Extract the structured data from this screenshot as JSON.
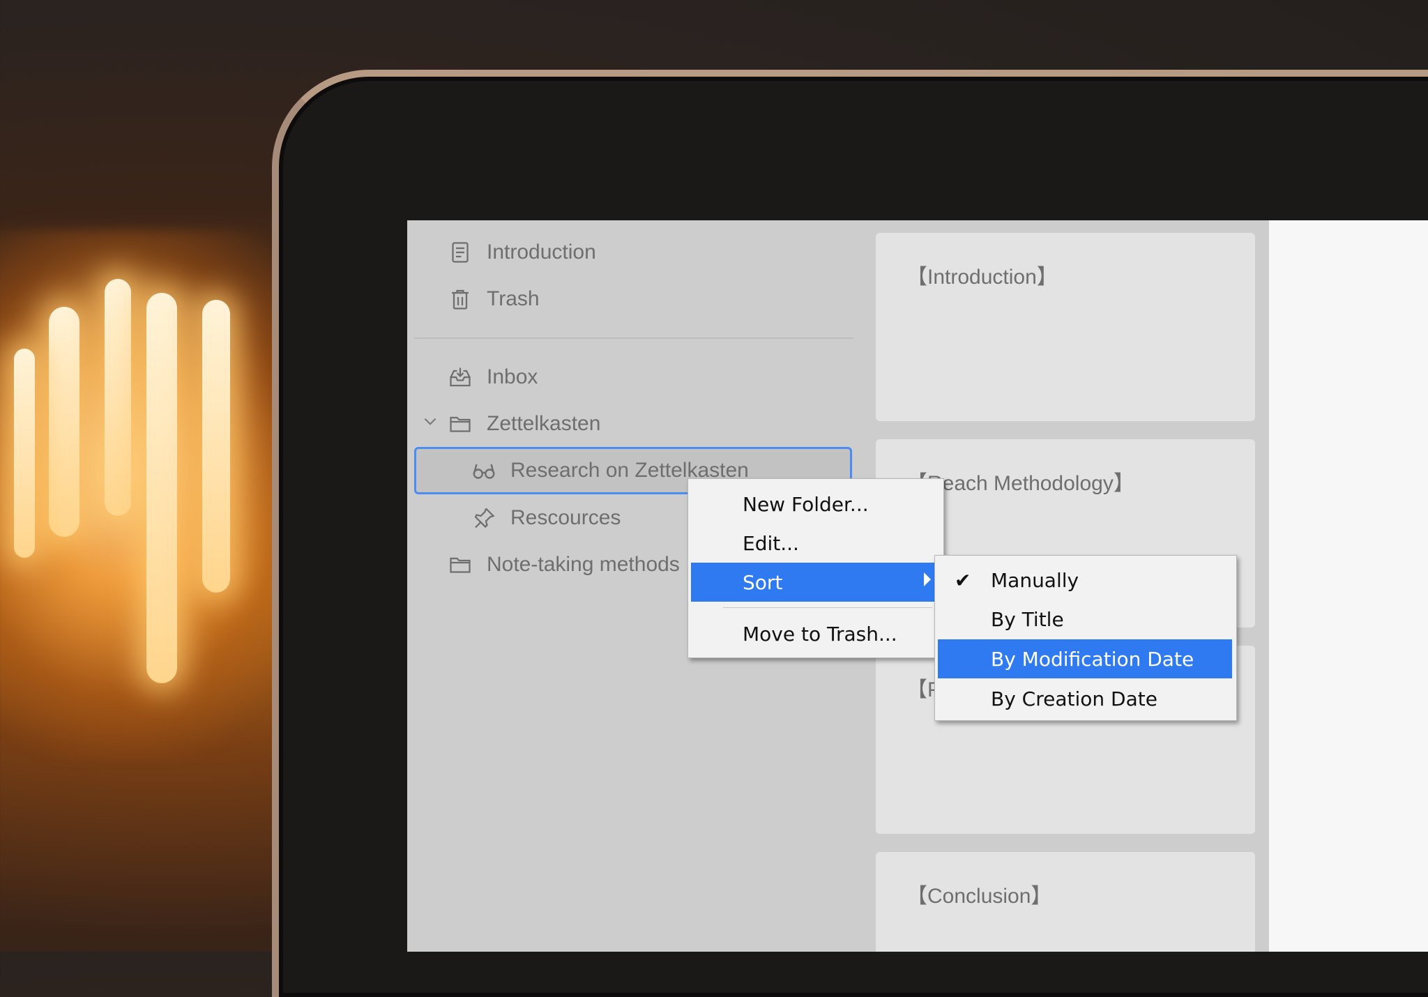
{
  "sidebar": {
    "items": [
      {
        "label": "Introduction",
        "icon": "document-icon"
      },
      {
        "label": "Trash",
        "icon": "trash-icon"
      },
      {
        "label": "Inbox",
        "icon": "inbox-icon"
      },
      {
        "label": "Zettelkasten",
        "icon": "folder-icon"
      },
      {
        "label": "Research on Zettelkasten",
        "icon": "glasses-icon"
      },
      {
        "label": "Rescources",
        "icon": "pin-icon"
      },
      {
        "label": "Note-taking methods",
        "icon": "folder-icon"
      }
    ]
  },
  "cards": [
    {
      "title": "【Introduction】"
    },
    {
      "title": "【Reach Methodology】"
    },
    {
      "title": "【P"
    },
    {
      "title": "【Conclusion】"
    }
  ],
  "context_menu": {
    "items": [
      {
        "label": "New Folder...",
        "underline": "F"
      },
      {
        "label": "Edit..."
      },
      {
        "label": "Sort",
        "highlighted": true
      },
      {
        "label": "Move to Trash..."
      }
    ]
  },
  "sort_menu": {
    "items": [
      {
        "label": "Manually",
        "checked": true
      },
      {
        "label": "By Title"
      },
      {
        "label": "By Modification Date",
        "highlighted": true
      },
      {
        "label": "By Creation Date"
      }
    ]
  },
  "colors": {
    "highlight": "#2f7af0",
    "selection_border": "#4a8cf0",
    "sidebar_bg": "#cdcdcd",
    "card_bg": "#e3e3e3"
  }
}
